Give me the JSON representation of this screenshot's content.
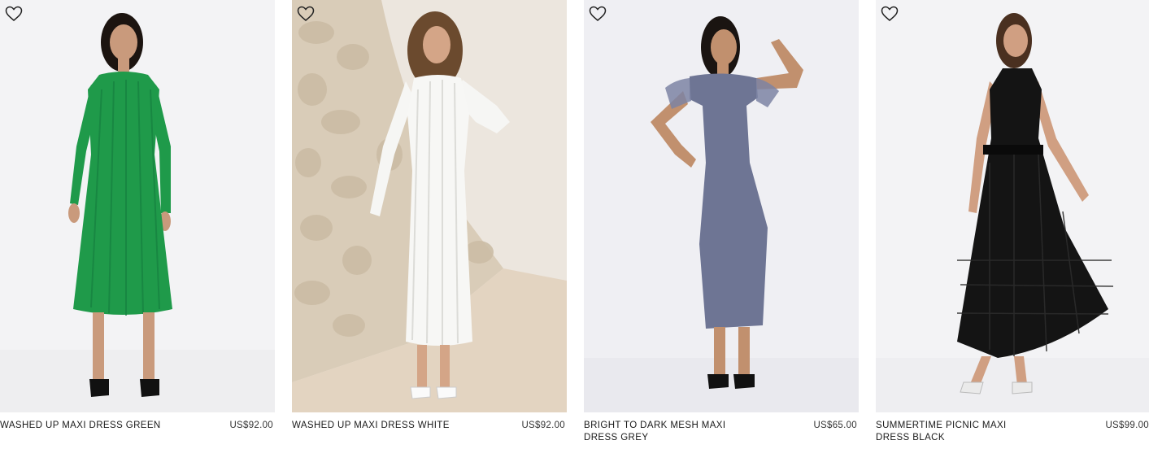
{
  "products": [
    {
      "name": "WASHED UP MAXI DRESS GREEN",
      "price": "US$92.00",
      "dress_color": "#1f9a4a",
      "background": "#f2f2f4",
      "wishlist_icon": "heart-outline-icon"
    },
    {
      "name": "WASHED UP MAXI DRESS WHITE",
      "price": "US$92.00",
      "dress_color": "#f4f4f2",
      "background": "#ece6de",
      "wishlist_icon": "heart-outline-icon"
    },
    {
      "name": "BRIGHT TO DARK MESH MAXI DRESS GREY",
      "price": "US$65.00",
      "dress_color": "#6e7594",
      "background": "#eeeef2",
      "wishlist_icon": "heart-outline-icon"
    },
    {
      "name": "SUMMERTIME PICNIC MAXI DRESS BLACK",
      "price": "US$99.00",
      "dress_color": "#141414",
      "background": "#f2f2f4",
      "wishlist_icon": "heart-outline-icon"
    }
  ]
}
